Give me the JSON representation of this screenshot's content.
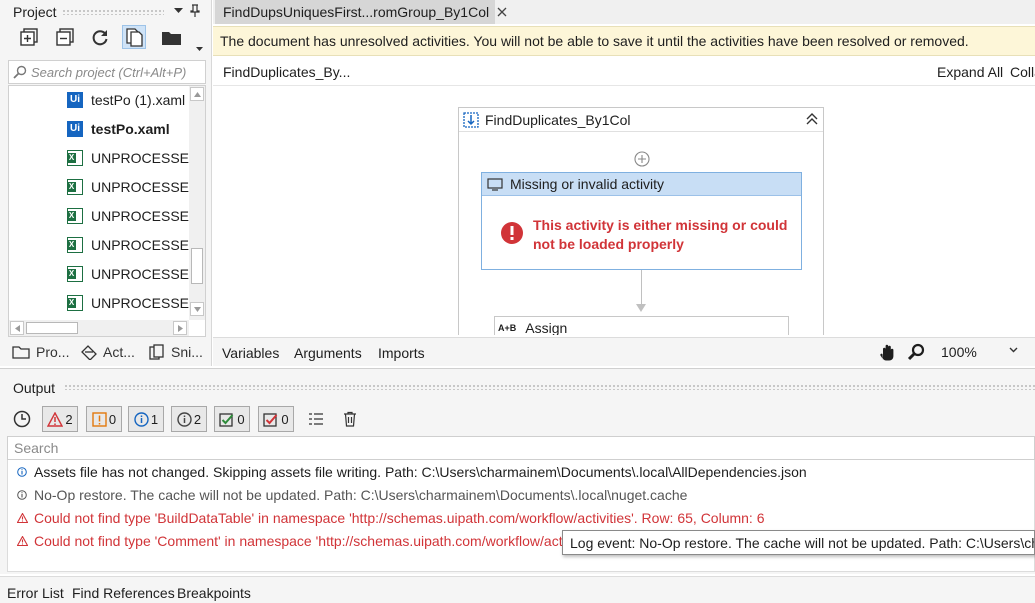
{
  "project_panel": {
    "title": "Project",
    "search_placeholder": "Search project (Ctrl+Alt+P)",
    "files": [
      {
        "name": "testPo (1).xaml",
        "type": "ui",
        "bold": false
      },
      {
        "name": "testPo.xaml",
        "type": "ui",
        "bold": true
      },
      {
        "name": "UNPROCESSED IN",
        "type": "excel",
        "bold": false
      },
      {
        "name": "UNPROCESSED IN",
        "type": "excel",
        "bold": false
      },
      {
        "name": "UNPROCESSED RT",
        "type": "excel",
        "bold": false
      },
      {
        "name": "UNPROCESSED RT",
        "type": "excel",
        "bold": false
      },
      {
        "name": "UNPROCESSED RT",
        "type": "excel",
        "bold": false
      },
      {
        "name": "UNPROCESSED RT",
        "type": "excel",
        "bold": false
      }
    ],
    "bottom_tabs": [
      "Pro...",
      "Act...",
      "Sni..."
    ]
  },
  "document": {
    "tab_title": "FindDupsUniquesFirst...romGroup_By1Col",
    "warning": "The document has unresolved activities. You will not be able to save it until the activities have been resolved or removed.",
    "breadcrumb": "FindDuplicates_By...",
    "expand_all": "Expand All",
    "collapse_all": "Colla",
    "sequence_title": "FindDuplicates_By1Col",
    "missing_activity": {
      "title": "Missing or invalid activity",
      "message": "This activity is either missing or could not be loaded properly"
    },
    "assign_label": "Assign",
    "bottom_tabs": [
      "Variables",
      "Arguments",
      "Imports"
    ],
    "zoom": "100%"
  },
  "output_panel": {
    "title": "Output",
    "filters": [
      {
        "count": "2",
        "kind": "error"
      },
      {
        "count": "0",
        "kind": "warning"
      },
      {
        "count": "1",
        "kind": "info"
      },
      {
        "count": "2",
        "kind": "trace"
      },
      {
        "count": "0",
        "kind": "success"
      },
      {
        "count": "0",
        "kind": "fail"
      }
    ],
    "search_placeholder": "Search",
    "logs": [
      {
        "level": "info",
        "text": "Assets file has not changed. Skipping assets file writing. Path: C:\\Users\\charmainem\\Documents\\.local\\AllDependencies.json"
      },
      {
        "level": "trace",
        "text": "No-Op restore. The cache will not be updated. Path: C:\\Users\\charmainem\\Documents\\.local\\nuget.cache"
      },
      {
        "level": "error",
        "text": "Could not find type 'BuildDataTable' in namespace 'http://schemas.uipath.com/workflow/activities'. Row: 65, Column: 6"
      },
      {
        "level": "error",
        "text": "Could not find type 'Comment' in namespace 'http://schemas.uipath.com/workflow/activities"
      }
    ],
    "tooltip": "Log event: No-Op restore. The cache will not be updated. Path: C:\\Users\\charm"
  },
  "bottom_tabs": [
    "Error List",
    "Find References",
    "Breakpoints"
  ],
  "colors": {
    "accent": "#0078d4",
    "error": "#d13438",
    "warning_bg": "#fdf6d8",
    "activity_header": "#c8def5"
  }
}
